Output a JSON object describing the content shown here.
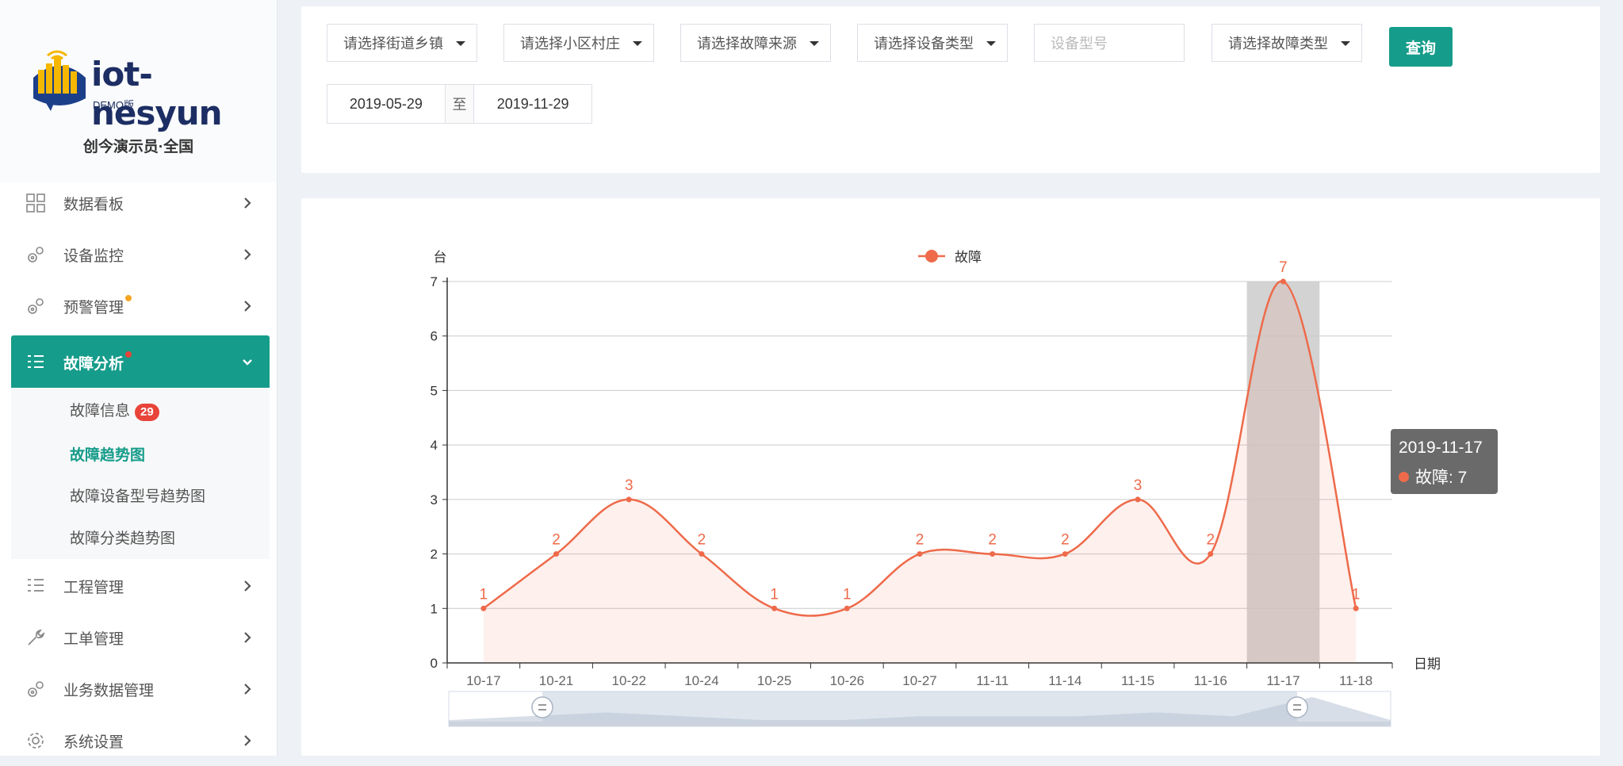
{
  "brand": {
    "name": "iot-nesyun",
    "edition": "DEMO版",
    "org": "创今演示员·全国"
  },
  "menu": [
    {
      "label": "数据看板",
      "icon": "dashboard-icon"
    },
    {
      "label": "设备监控",
      "icon": "gears-icon"
    },
    {
      "label": "预警管理",
      "icon": "gears-icon",
      "dot": true
    },
    {
      "label": "故障分析",
      "icon": "list-icon",
      "dot": true,
      "active": true
    },
    {
      "label": "工程管理",
      "icon": "list-icon"
    },
    {
      "label": "工单管理",
      "icon": "wrench-icon"
    },
    {
      "label": "业务数据管理",
      "icon": "gears-icon"
    },
    {
      "label": "系统设置",
      "icon": "cog-icon"
    }
  ],
  "submenu": [
    {
      "label": "故障信息",
      "badge": "29"
    },
    {
      "label": "故障趋势图",
      "active": true
    },
    {
      "label": "故障设备型号趋势图"
    },
    {
      "label": "故障分类趋势图"
    }
  ],
  "filters": {
    "street": "请选择街道乡镇",
    "community": "请选择小区村庄",
    "source": "请选择故障来源",
    "device_type": "请选择设备类型",
    "model_placeholder": "设备型号",
    "fault_type": "请选择故障类型",
    "query_label": "查询",
    "date_start": "2019-05-29",
    "date_sep": "至",
    "date_end": "2019-11-29"
  },
  "colors": {
    "accent": "#169c8a",
    "series": "#ee6a4a",
    "badge": "#e8443a",
    "dot_warn": "#f5a623",
    "dot_alert": "#e8443a"
  },
  "chart_data": {
    "type": "area",
    "y_unit_label": "台",
    "xlabel": "日期",
    "legend": "故障",
    "legend_position": "top-center",
    "categories": [
      "10-17",
      "10-21",
      "10-22",
      "10-24",
      "10-25",
      "10-26",
      "10-27",
      "11-11",
      "11-14",
      "11-15",
      "11-16",
      "11-17",
      "11-18"
    ],
    "series": [
      {
        "name": "故障",
        "values": [
          1,
          2,
          3,
          2,
          1,
          1,
          2,
          2,
          2,
          3,
          2,
          7,
          1
        ]
      }
    ],
    "ylim": [
      0,
      7
    ],
    "yticks": [
      0,
      1,
      2,
      3,
      4,
      5,
      6,
      7
    ],
    "highlight_index": 11,
    "grid": true,
    "smooth": true
  },
  "tooltip": {
    "date": "2019-11-17",
    "label": "故障: 7"
  }
}
